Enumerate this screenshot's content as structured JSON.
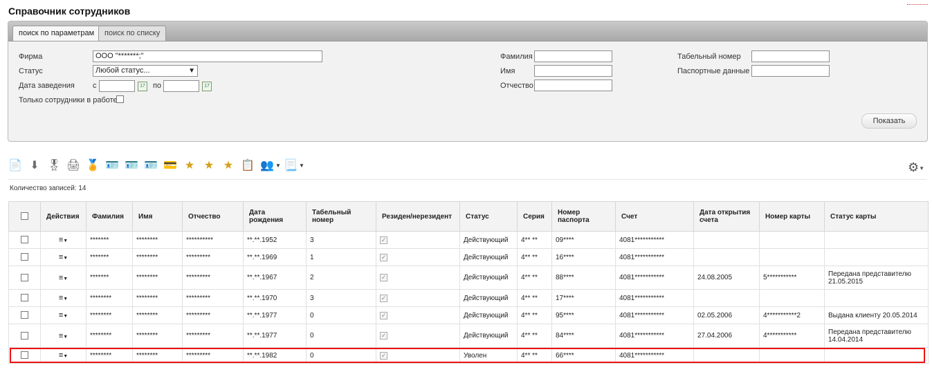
{
  "page": {
    "title": "Справочник сотрудников"
  },
  "tabs": [
    {
      "label": "поиск по параметрам",
      "active": true
    },
    {
      "label": "поиск по списку",
      "active": false
    }
  ],
  "form": {
    "firm_label": "Фирма",
    "firm_value": "ООО \"*******;\"",
    "status_label": "Статус",
    "status_value": "Любой статус...",
    "date_label": "Дата заведения",
    "date_from_label": "с",
    "date_to_label": "по",
    "only_working_label": "Только сотрудники в работе",
    "lastname_label": "Фамилия",
    "firstname_label": "Имя",
    "middlename_label": "Отчество",
    "tabnum_label": "Табельный номер",
    "passport_label": "Паспортные данные",
    "show_button": "Показать"
  },
  "toolbar": {
    "icons": [
      "new-document-icon",
      "download-icon",
      "award-icon",
      "print-icon",
      "award-check-icon",
      "id-card-icon",
      "id-card-2-icon",
      "id-card-add-icon",
      "card-icon",
      "star-icon",
      "star-add-icon",
      "star-remove-icon",
      "report-icon",
      "users-icon",
      "document-menu-icon"
    ]
  },
  "records": {
    "label": "Количество записей: 14"
  },
  "table": {
    "headers": [
      "",
      "Действия",
      "Фамилия",
      "Имя",
      "Отчество",
      "Дата рождения",
      "Табельный номер",
      "Резиден/нерезидент",
      "Статус",
      "Серия",
      "Номер паспорта",
      "Счет",
      "Дата открытия счета",
      "Номер карты",
      "Статус карты"
    ],
    "rows": [
      {
        "lastname": "*******",
        "firstname": "********",
        "middlename": "**********",
        "birth": "**.**.1952",
        "tabnum": "3",
        "status": "Действующий",
        "series": "4** **",
        "passport": "09****",
        "account": "4081***********",
        "acc_date": "",
        "card": "",
        "card_status": ""
      },
      {
        "lastname": "*******",
        "firstname": "********",
        "middlename": "*********",
        "birth": "**.**.1969",
        "tabnum": "1",
        "status": "Действующий",
        "series": "4** **",
        "passport": "16****",
        "account": "4081***********",
        "acc_date": "",
        "card": "",
        "card_status": ""
      },
      {
        "lastname": "*******",
        "firstname": "********",
        "middlename": "*********",
        "birth": "**.**.1967",
        "tabnum": "2",
        "status": "Действующий",
        "series": "4** **",
        "passport": "88****",
        "account": "4081***********",
        "acc_date": "24.08.2005",
        "card": "5***********",
        "card_status": "Передана представителю 21.05.2015"
      },
      {
        "lastname": "********",
        "firstname": "********",
        "middlename": "*********",
        "birth": "**.**.1970",
        "tabnum": "3",
        "status": "Действующий",
        "series": "4** **",
        "passport": "17****",
        "account": "4081***********",
        "acc_date": "",
        "card": "",
        "card_status": ""
      },
      {
        "lastname": "********",
        "firstname": "********",
        "middlename": "*********",
        "birth": "**.**.1977",
        "tabnum": "0",
        "status": "Действующий",
        "series": "4** **",
        "passport": "95****",
        "account": "4081***********",
        "acc_date": "02.05.2006",
        "card": "4***********2",
        "card_status": "Выдана клиенту 20.05.2014"
      },
      {
        "lastname": "********",
        "firstname": "********",
        "middlename": "*********",
        "birth": "**.**.1977",
        "tabnum": "0",
        "status": "Действующий",
        "series": "4** **",
        "passport": "84****",
        "account": "4081***********",
        "acc_date": "27.04.2006",
        "card": "4***********",
        "card_status": "Передана представителю 14.04.2014"
      },
      {
        "lastname": "********",
        "firstname": "********",
        "middlename": "*********",
        "birth": "**.**.1982",
        "tabnum": "0",
        "status": "Уволен",
        "series": "4** **",
        "passport": "66****",
        "account": "4081***********",
        "acc_date": "",
        "card": "",
        "card_status": ""
      }
    ]
  }
}
